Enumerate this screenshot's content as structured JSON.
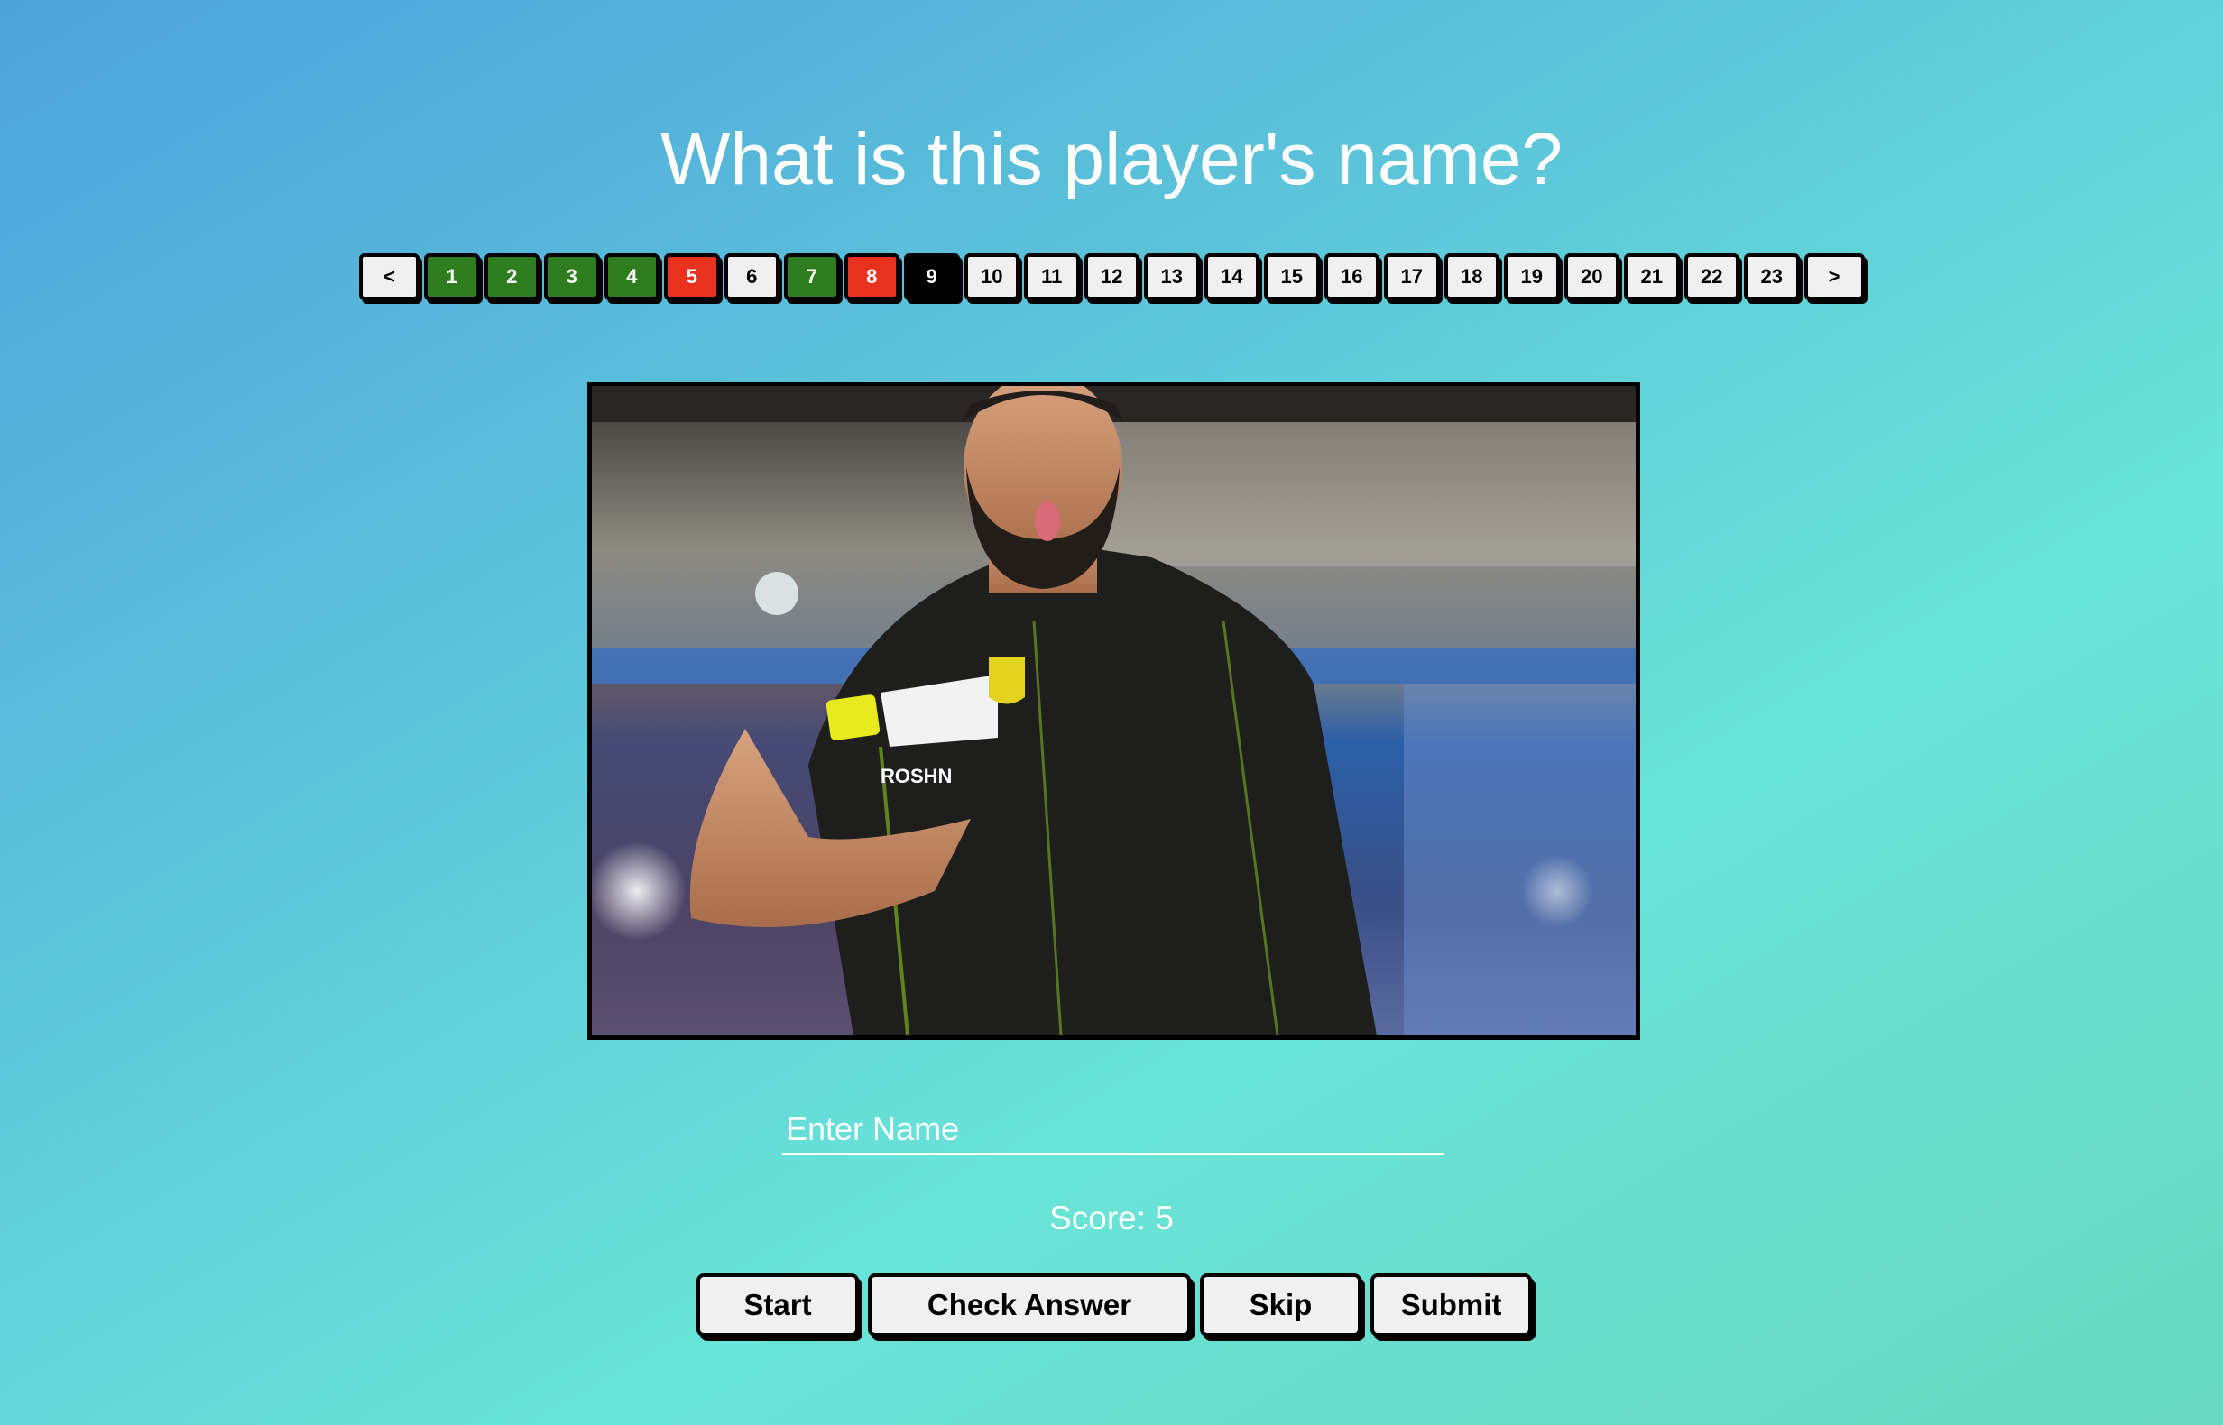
{
  "title": "What is this player's name?",
  "pager": {
    "prev_label": "<",
    "next_label": ">",
    "pages": [
      {
        "label": "1",
        "status": "correct"
      },
      {
        "label": "2",
        "status": "correct"
      },
      {
        "label": "3",
        "status": "correct"
      },
      {
        "label": "4",
        "status": "correct"
      },
      {
        "label": "5",
        "status": "wrong"
      },
      {
        "label": "6",
        "status": "unanswered"
      },
      {
        "label": "7",
        "status": "correct"
      },
      {
        "label": "8",
        "status": "wrong"
      },
      {
        "label": "9",
        "status": "current"
      },
      {
        "label": "10",
        "status": "unanswered"
      },
      {
        "label": "11",
        "status": "unanswered"
      },
      {
        "label": "12",
        "status": "unanswered"
      },
      {
        "label": "13",
        "status": "unanswered"
      },
      {
        "label": "14",
        "status": "unanswered"
      },
      {
        "label": "15",
        "status": "unanswered"
      },
      {
        "label": "16",
        "status": "unanswered"
      },
      {
        "label": "17",
        "status": "unanswered"
      },
      {
        "label": "18",
        "status": "unanswered"
      },
      {
        "label": "19",
        "status": "unanswered"
      },
      {
        "label": "20",
        "status": "unanswered"
      },
      {
        "label": "21",
        "status": "unanswered"
      },
      {
        "label": "22",
        "status": "unanswered"
      },
      {
        "label": "23",
        "status": "unanswered"
      }
    ]
  },
  "photo": {
    "jersey_text": "ROSHN",
    "jersey_color": "#1e1e1c"
  },
  "answer": {
    "placeholder": "Enter Name",
    "value": ""
  },
  "score": {
    "text": "Score: 5"
  },
  "actions": {
    "start_label": "Start",
    "check_label": "Check Answer",
    "skip_label": "Skip",
    "submit_label": "Submit"
  },
  "colors": {
    "correct": "#2e7d1e",
    "wrong": "#e8321f",
    "current": "#000000",
    "unanswered": "#f0f0f0"
  }
}
